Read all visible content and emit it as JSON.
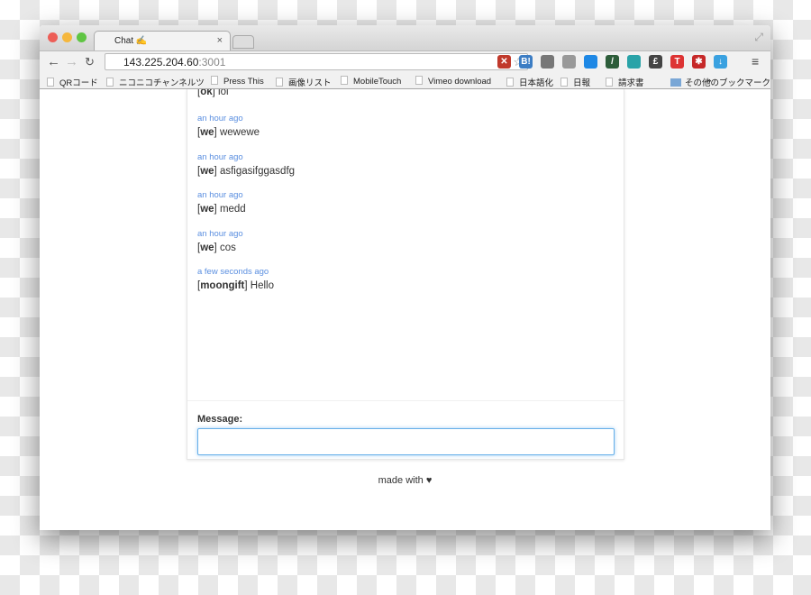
{
  "browser": {
    "tab_title": "Chat ✍",
    "tab_close": "×",
    "url_host": "143.225.204.60",
    "url_port": ":3001",
    "extensions": [
      {
        "name": "adblock-icon",
        "label": "✕",
        "color": "#c0392b"
      },
      {
        "name": "hatena-bookmark-icon",
        "label": "B!",
        "color": "#3c7dc4"
      },
      {
        "name": "evernote-icon",
        "label": "",
        "color": "#777"
      },
      {
        "name": "tab-icon",
        "label": "",
        "color": "#999"
      },
      {
        "name": "globe-icon",
        "label": "",
        "color": "#1e88e5"
      },
      {
        "name": "eyedropper-icon",
        "label": "/",
        "color": "#2d5d3a"
      },
      {
        "name": "wave-icon",
        "label": "",
        "color": "#2aa3a8"
      },
      {
        "name": "pound-icon",
        "label": "£",
        "color": "#444"
      },
      {
        "name": "todo-icon",
        "label": "T",
        "color": "#d33"
      },
      {
        "name": "asterisk-icon",
        "label": "✱",
        "color": "#c62828"
      },
      {
        "name": "download-icon",
        "label": "↓",
        "color": "#3aa1e0"
      }
    ],
    "bookmarks": [
      "QRコード",
      "ニコニコチャンネルツ",
      "Press This",
      "画像リスト",
      "MobileTouch",
      "Vimeo download",
      "日本語化",
      "日報",
      "請求書"
    ],
    "bookmarks_more": "»",
    "other_bookmarks": "その他のブックマーク"
  },
  "chat": {
    "messages": [
      {
        "time": "",
        "user": "ok",
        "text": "lol"
      },
      {
        "time": "an hour ago",
        "user": "we",
        "text": "wewewe"
      },
      {
        "time": "an hour ago",
        "user": "we",
        "text": "asfigasifggasdfg"
      },
      {
        "time": "an hour ago",
        "user": "we",
        "text": "medd"
      },
      {
        "time": "an hour ago",
        "user": "we",
        "text": "cos"
      },
      {
        "time": "a few seconds ago",
        "user": "moongift",
        "text": "Hello"
      }
    ],
    "message_label": "Message:",
    "message_value": ""
  },
  "footer": "made with ♥"
}
